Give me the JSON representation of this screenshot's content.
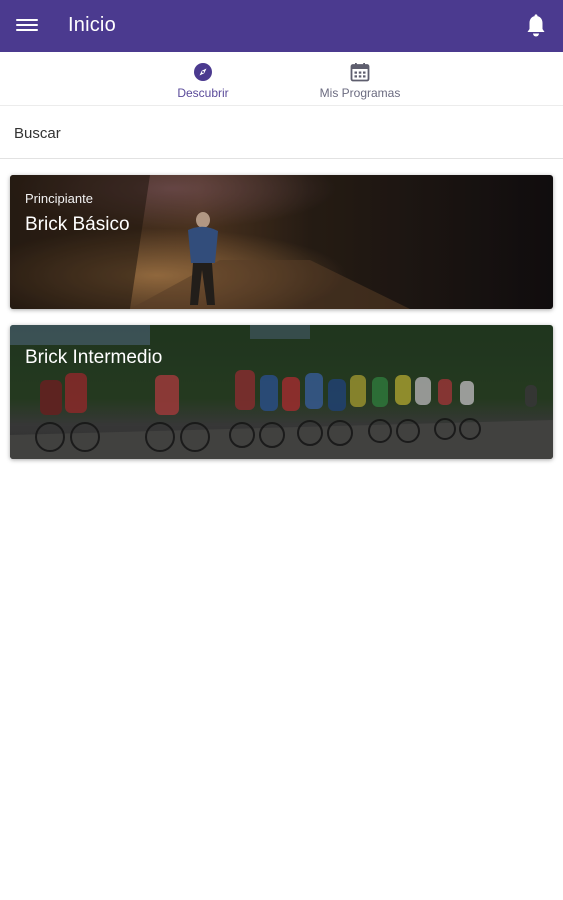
{
  "appbar": {
    "title": "Inicio",
    "menu_icon": "hamburger-menu-icon",
    "notification_icon": "bell-icon",
    "background_color": "#4b3a8f"
  },
  "tabs": [
    {
      "label": "Descubrir",
      "icon": "compass-icon",
      "active": true
    },
    {
      "label": "Mis Programas",
      "icon": "calendar-icon",
      "active": false
    }
  ],
  "search": {
    "placeholder": "Buscar"
  },
  "programs": [
    {
      "level": "Principiante",
      "title": "Brick Básico",
      "image": "runner-on-forest-path"
    },
    {
      "title": "Brick Intermedio",
      "image": "cycling-peloton"
    }
  ]
}
